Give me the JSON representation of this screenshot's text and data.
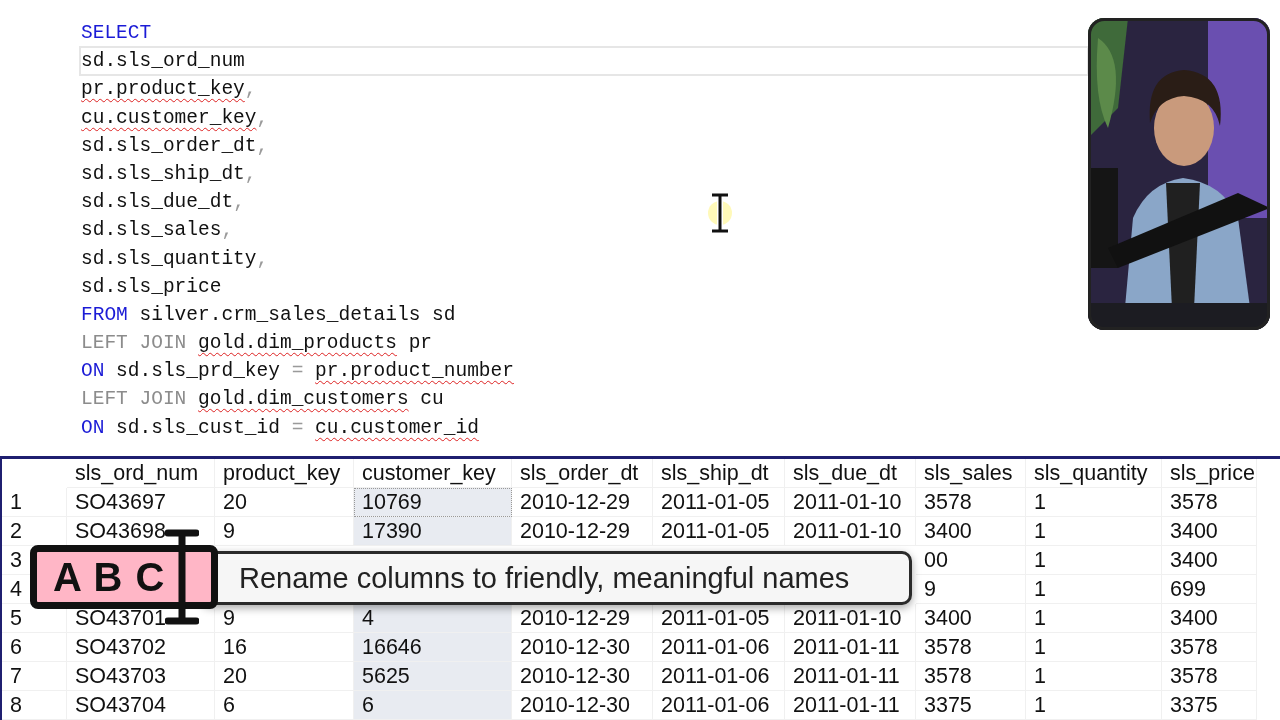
{
  "editor": {
    "lines": [
      {
        "current": false,
        "segments": [
          {
            "kind": "keyword",
            "text": "SELECT"
          }
        ]
      },
      {
        "current": true,
        "segments": [
          {
            "kind": "text",
            "text": "sd.sls_ord_num"
          }
        ]
      },
      {
        "current": false,
        "segments": [
          {
            "kind": "flagged",
            "text": "pr.product_key"
          },
          {
            "kind": "punct",
            "text": ","
          }
        ]
      },
      {
        "current": false,
        "segments": [
          {
            "kind": "flagged",
            "text": "cu.customer_key"
          },
          {
            "kind": "punct",
            "text": ","
          }
        ]
      },
      {
        "current": false,
        "segments": [
          {
            "kind": "text",
            "text": "sd.sls_order_dt"
          },
          {
            "kind": "punct",
            "text": ","
          }
        ]
      },
      {
        "current": false,
        "segments": [
          {
            "kind": "text",
            "text": "sd.sls_ship_dt"
          },
          {
            "kind": "punct",
            "text": ","
          }
        ]
      },
      {
        "current": false,
        "segments": [
          {
            "kind": "text",
            "text": "sd.sls_due_dt"
          },
          {
            "kind": "punct",
            "text": ","
          }
        ]
      },
      {
        "current": false,
        "segments": [
          {
            "kind": "text",
            "text": "sd.sls_sales"
          },
          {
            "kind": "punct",
            "text": ","
          }
        ]
      },
      {
        "current": false,
        "segments": [
          {
            "kind": "text",
            "text": "sd.sls_quantity"
          },
          {
            "kind": "punct",
            "text": ","
          }
        ]
      },
      {
        "current": false,
        "segments": [
          {
            "kind": "text",
            "text": "sd.sls_price"
          }
        ]
      },
      {
        "current": false,
        "segments": [
          {
            "kind": "keyword",
            "text": "FROM"
          },
          {
            "kind": "text",
            "text": " silver.crm_sales_details sd"
          }
        ]
      },
      {
        "current": false,
        "segments": [
          {
            "kind": "join",
            "text": "LEFT JOIN "
          },
          {
            "kind": "flagged",
            "text": "gold.dim_products"
          },
          {
            "kind": "text",
            "text": " pr"
          }
        ]
      },
      {
        "current": false,
        "segments": [
          {
            "kind": "keyword",
            "text": "ON"
          },
          {
            "kind": "text",
            "text": " sd.sls_prd_key "
          },
          {
            "kind": "punct",
            "text": "= "
          },
          {
            "kind": "flagged",
            "text": "pr.product_number"
          }
        ]
      },
      {
        "current": false,
        "segments": [
          {
            "kind": "join",
            "text": "LEFT JOIN "
          },
          {
            "kind": "flagged",
            "text": "gold.dim_customers"
          },
          {
            "kind": "text",
            "text": " cu"
          }
        ]
      },
      {
        "current": false,
        "segments": [
          {
            "kind": "keyword",
            "text": "ON"
          },
          {
            "kind": "text",
            "text": " sd.sls_cust_id "
          },
          {
            "kind": "punct",
            "text": "= "
          },
          {
            "kind": "flagged",
            "text": "cu.customer_id"
          }
        ]
      }
    ]
  },
  "results": {
    "columns": [
      {
        "label": "sls_ord_num",
        "selected": false
      },
      {
        "label": "product_key",
        "selected": false
      },
      {
        "label": "customer_key",
        "selected": true
      },
      {
        "label": "sls_order_dt",
        "selected": false
      },
      {
        "label": "sls_ship_dt",
        "selected": false
      },
      {
        "label": "sls_due_dt",
        "selected": false
      },
      {
        "label": "sls_sales",
        "selected": false
      },
      {
        "label": "sls_quantity",
        "selected": false
      },
      {
        "label": "sls_price",
        "selected": false
      }
    ],
    "rows": [
      {
        "number": "1",
        "cells": [
          "SO43697",
          "20",
          "10769",
          "2010-12-29",
          "2011-01-05",
          "2011-01-10",
          "3578",
          "1",
          "3578"
        ]
      },
      {
        "number": "2",
        "cells": [
          "SO43698",
          "9",
          "17390",
          "2010-12-29",
          "2011-01-05",
          "2011-01-10",
          "3400",
          "1",
          "3400"
        ]
      },
      {
        "number": "3",
        "cells": [
          null,
          null,
          null,
          null,
          null,
          null,
          "00",
          "1",
          "3400"
        ]
      },
      {
        "number": "4",
        "cells": [
          null,
          null,
          null,
          null,
          null,
          null,
          "9",
          "1",
          "699"
        ]
      },
      {
        "number": "5",
        "cells": [
          "SO43701",
          "9",
          "4",
          "2010-12-29",
          "2011-01-05",
          "2011-01-10",
          "3400",
          "1",
          "3400"
        ]
      },
      {
        "number": "6",
        "cells": [
          "SO43702",
          "16",
          "16646",
          "2010-12-30",
          "2011-01-06",
          "2011-01-11",
          "3578",
          "1",
          "3578"
        ]
      },
      {
        "number": "7",
        "cells": [
          "SO43703",
          "20",
          "5625",
          "2010-12-30",
          "2011-01-06",
          "2011-01-11",
          "3578",
          "1",
          "3578"
        ]
      },
      {
        "number": "8",
        "cells": [
          "SO43704",
          "6",
          "6",
          "2010-12-30",
          "2011-01-06",
          "2011-01-11",
          "3375",
          "1",
          "3375"
        ]
      }
    ]
  },
  "caption": {
    "badge": "A B C",
    "text": "Rename columns to friendly, meaningful names"
  }
}
